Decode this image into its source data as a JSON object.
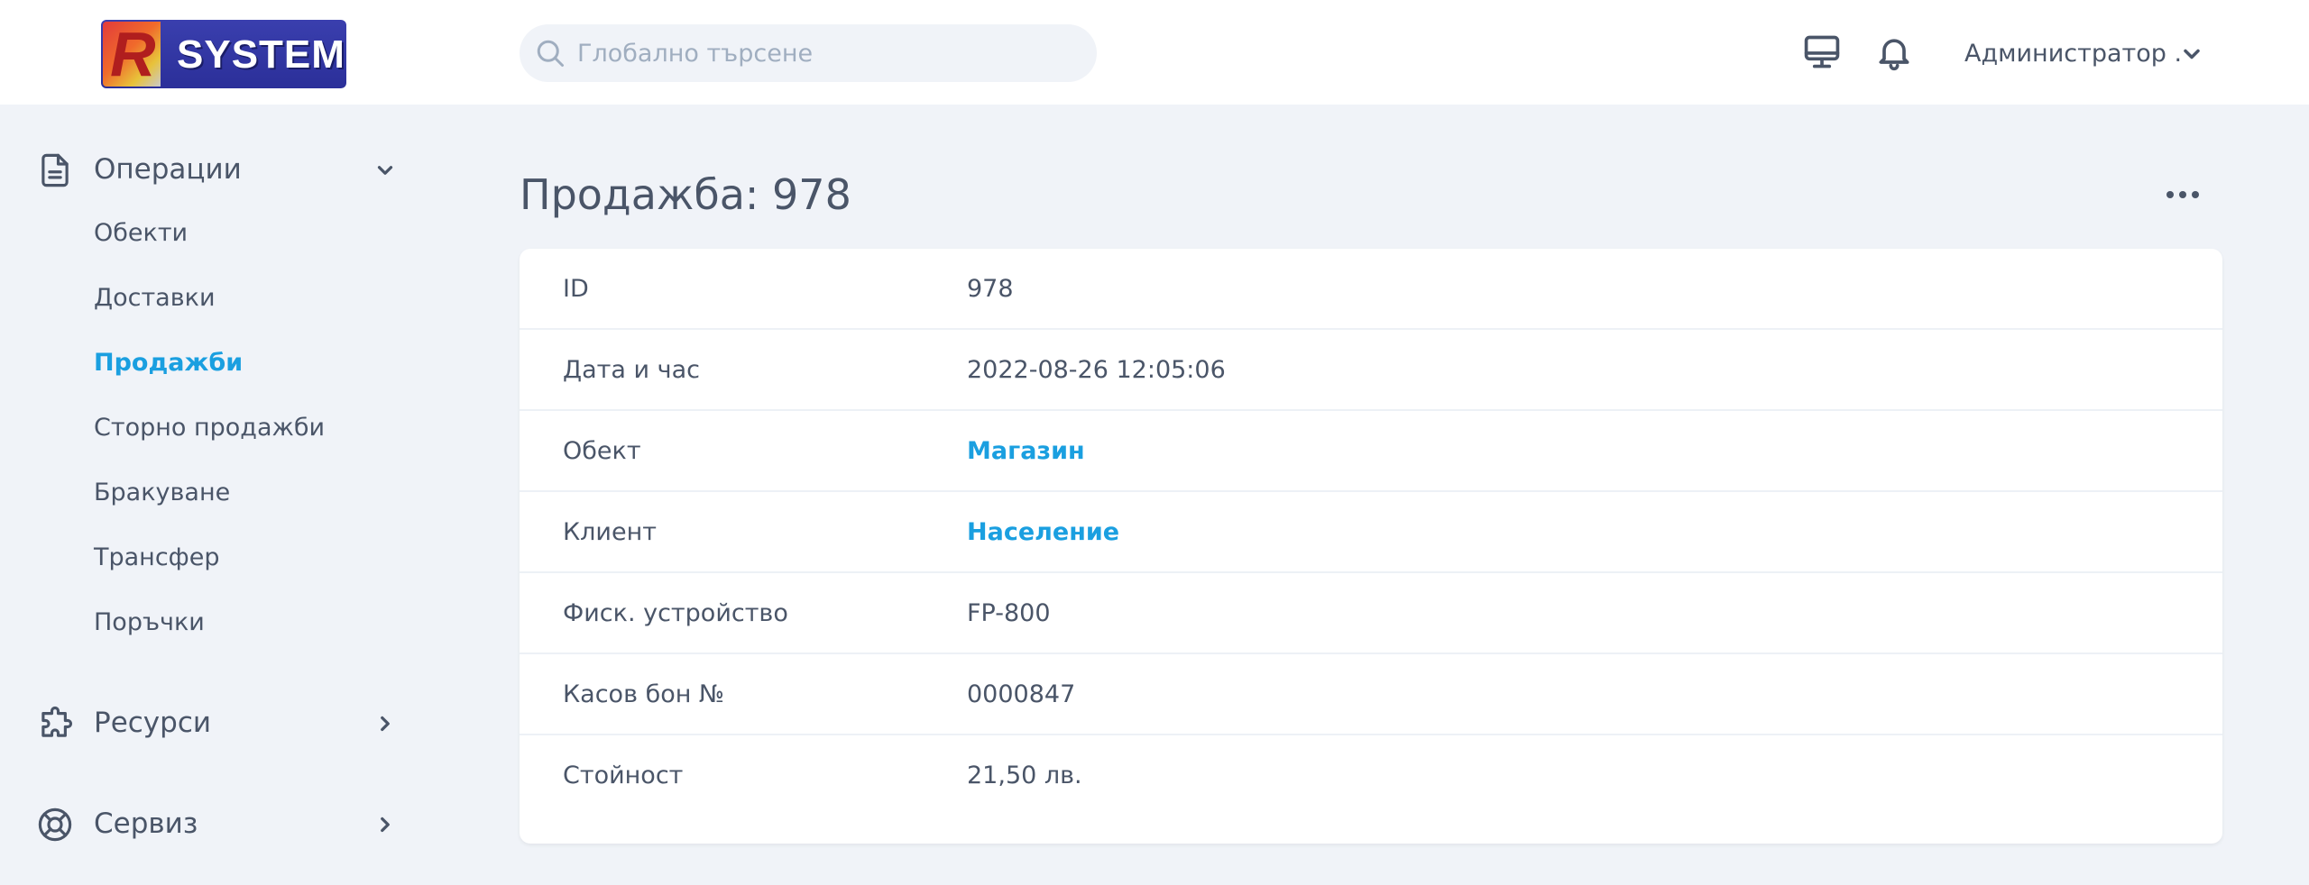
{
  "brand": {
    "logo_letter": "R",
    "logo_text": "SYSTEM"
  },
  "search": {
    "placeholder": "Глобално търсене",
    "value": ""
  },
  "header": {
    "icons": [
      "monitor-icon",
      "bell-icon"
    ],
    "user_name": "Администратор ."
  },
  "sidebar": {
    "groups": [
      {
        "label": "Операции",
        "icon": "document-icon",
        "expanded": true,
        "items": [
          {
            "label": "Обекти",
            "active": false
          },
          {
            "label": "Доставки",
            "active": false
          },
          {
            "label": "Продажби",
            "active": true
          },
          {
            "label": "Сторно продажби",
            "active": false
          },
          {
            "label": "Бракуване",
            "active": false
          },
          {
            "label": "Трансфер",
            "active": false
          },
          {
            "label": "Поръчки",
            "active": false
          }
        ]
      },
      {
        "label": "Ресурси",
        "icon": "puzzle-icon",
        "expanded": false
      },
      {
        "label": "Сервиз",
        "icon": "lifebuoy-icon",
        "expanded": false
      }
    ]
  },
  "main": {
    "title": "Продажба: 978",
    "details": [
      {
        "key": "ID",
        "value": "978",
        "link": false
      },
      {
        "key": "Дата и час",
        "value": "2022-08-26 12:05:06",
        "link": false
      },
      {
        "key": "Обект",
        "value": "Магазин",
        "link": true
      },
      {
        "key": "Клиент",
        "value": "Население",
        "link": true
      },
      {
        "key": "Фиск. устройство",
        "value": "FP-800",
        "link": false
      },
      {
        "key": "Касов бон №",
        "value": "0000847",
        "link": false
      },
      {
        "key": "Стойност",
        "value": "21,50 лв.",
        "link": false
      }
    ]
  },
  "colors": {
    "accent": "#1a9fe0",
    "text": "#4a5568",
    "background": "#f0f3f8"
  }
}
